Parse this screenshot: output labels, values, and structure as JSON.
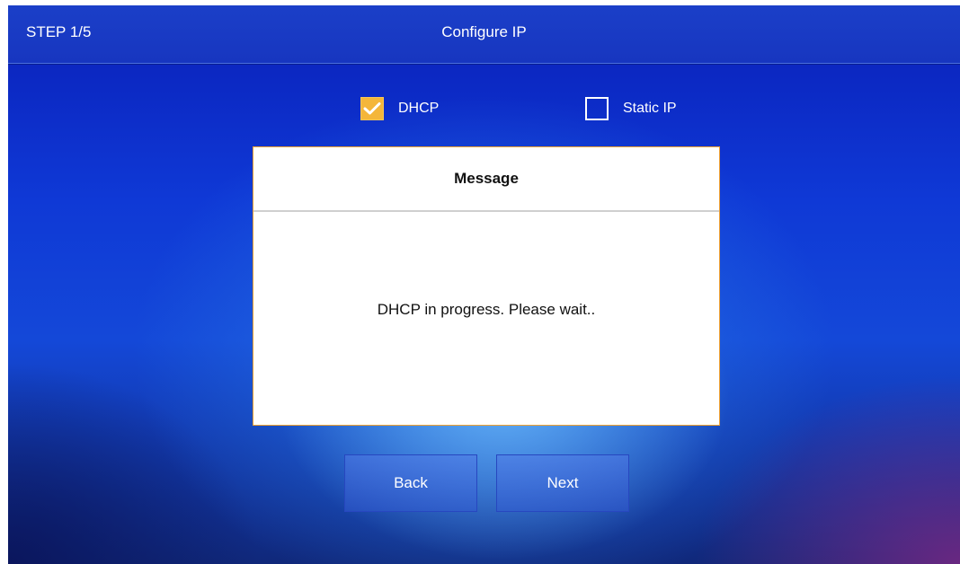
{
  "header": {
    "step": "STEP 1/5",
    "title": "Configure IP"
  },
  "options": {
    "dhcp": {
      "label": "DHCP",
      "checked": true
    },
    "static_ip": {
      "label": "Static IP",
      "checked": false
    }
  },
  "dialog": {
    "title": "Message",
    "message": "DHCP in progress. Please wait.."
  },
  "buttons": {
    "back": "Back",
    "next": "Next"
  },
  "colors": {
    "accent_checkbox": "#f4b63a",
    "dialog_border": "#f0a030",
    "background": "#1448d8"
  },
  "icons": {
    "checkmark": "check-icon"
  }
}
